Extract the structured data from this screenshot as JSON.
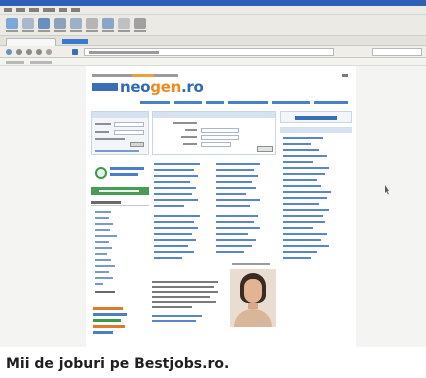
{
  "page": {
    "logo_prefix": "",
    "logo_brand_part1": "neo",
    "logo_brand_part2": "gen",
    "logo_suffix": ".ro"
  },
  "icons": [
    "browser-back-icon",
    "browser-forward-icon",
    "reload-icon",
    "home-icon",
    "cv-checkmark-icon",
    "mouse-cursor-icon"
  ],
  "colors": {
    "brand_blue": "#2f6ab5",
    "brand_orange": "#f08a1c",
    "accent_green": "#4a9a58",
    "browser_title_blue": "#2f5fb6"
  },
  "caption": "Mii de joburi pe Bestjobs.ro."
}
